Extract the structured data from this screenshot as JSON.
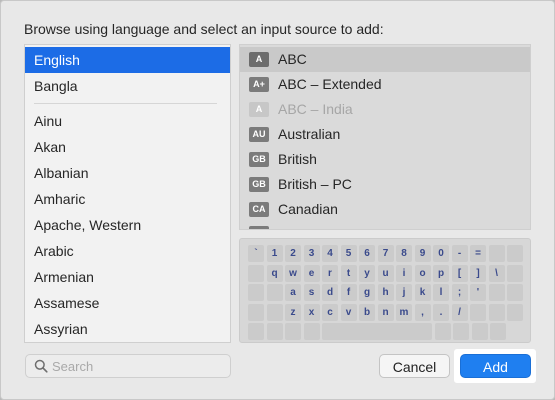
{
  "dialog": {
    "prompt": "Browse using language and select an input source to add:"
  },
  "languages": [
    {
      "label": "English",
      "selected": true
    },
    {
      "label": "Bangla"
    },
    {
      "label": "Ainu"
    },
    {
      "label": "Akan"
    },
    {
      "label": "Albanian"
    },
    {
      "label": "Amharic"
    },
    {
      "label": "Apache, Western"
    },
    {
      "label": "Arabic"
    },
    {
      "label": "Armenian"
    },
    {
      "label": "Assamese"
    },
    {
      "label": "Assyrian"
    }
  ],
  "sources": [
    {
      "badge": "A",
      "label": "ABC",
      "selected": true
    },
    {
      "badge": "A+",
      "label": "ABC – Extended"
    },
    {
      "badge": "A",
      "label": "ABC – India",
      "disabled": true
    },
    {
      "badge": "AU",
      "label": "Australian"
    },
    {
      "badge": "GB",
      "label": "British"
    },
    {
      "badge": "GB",
      "label": "British – PC"
    },
    {
      "badge": "CA",
      "label": "Canadian"
    }
  ],
  "keyboard": {
    "rows": [
      [
        "`",
        "1",
        "2",
        "3",
        "4",
        "5",
        "6",
        "7",
        "8",
        "9",
        "0",
        "-",
        "="
      ],
      [
        "q",
        "w",
        "e",
        "r",
        "t",
        "y",
        "u",
        "i",
        "o",
        "p",
        "[",
        "]",
        "\\"
      ],
      [
        "a",
        "s",
        "d",
        "f",
        "g",
        "h",
        "j",
        "k",
        "l",
        ";",
        "'"
      ],
      [
        "z",
        "x",
        "c",
        "v",
        "b",
        "n",
        "m",
        ",",
        ".",
        "/"
      ]
    ]
  },
  "search": {
    "placeholder": "Search",
    "value": ""
  },
  "buttons": {
    "cancel": "Cancel",
    "add": "Add"
  },
  "colors": {
    "accent": "#1c6ce6",
    "add_button": "#1f7ff0",
    "key_glyph": "#3a4a8c"
  }
}
